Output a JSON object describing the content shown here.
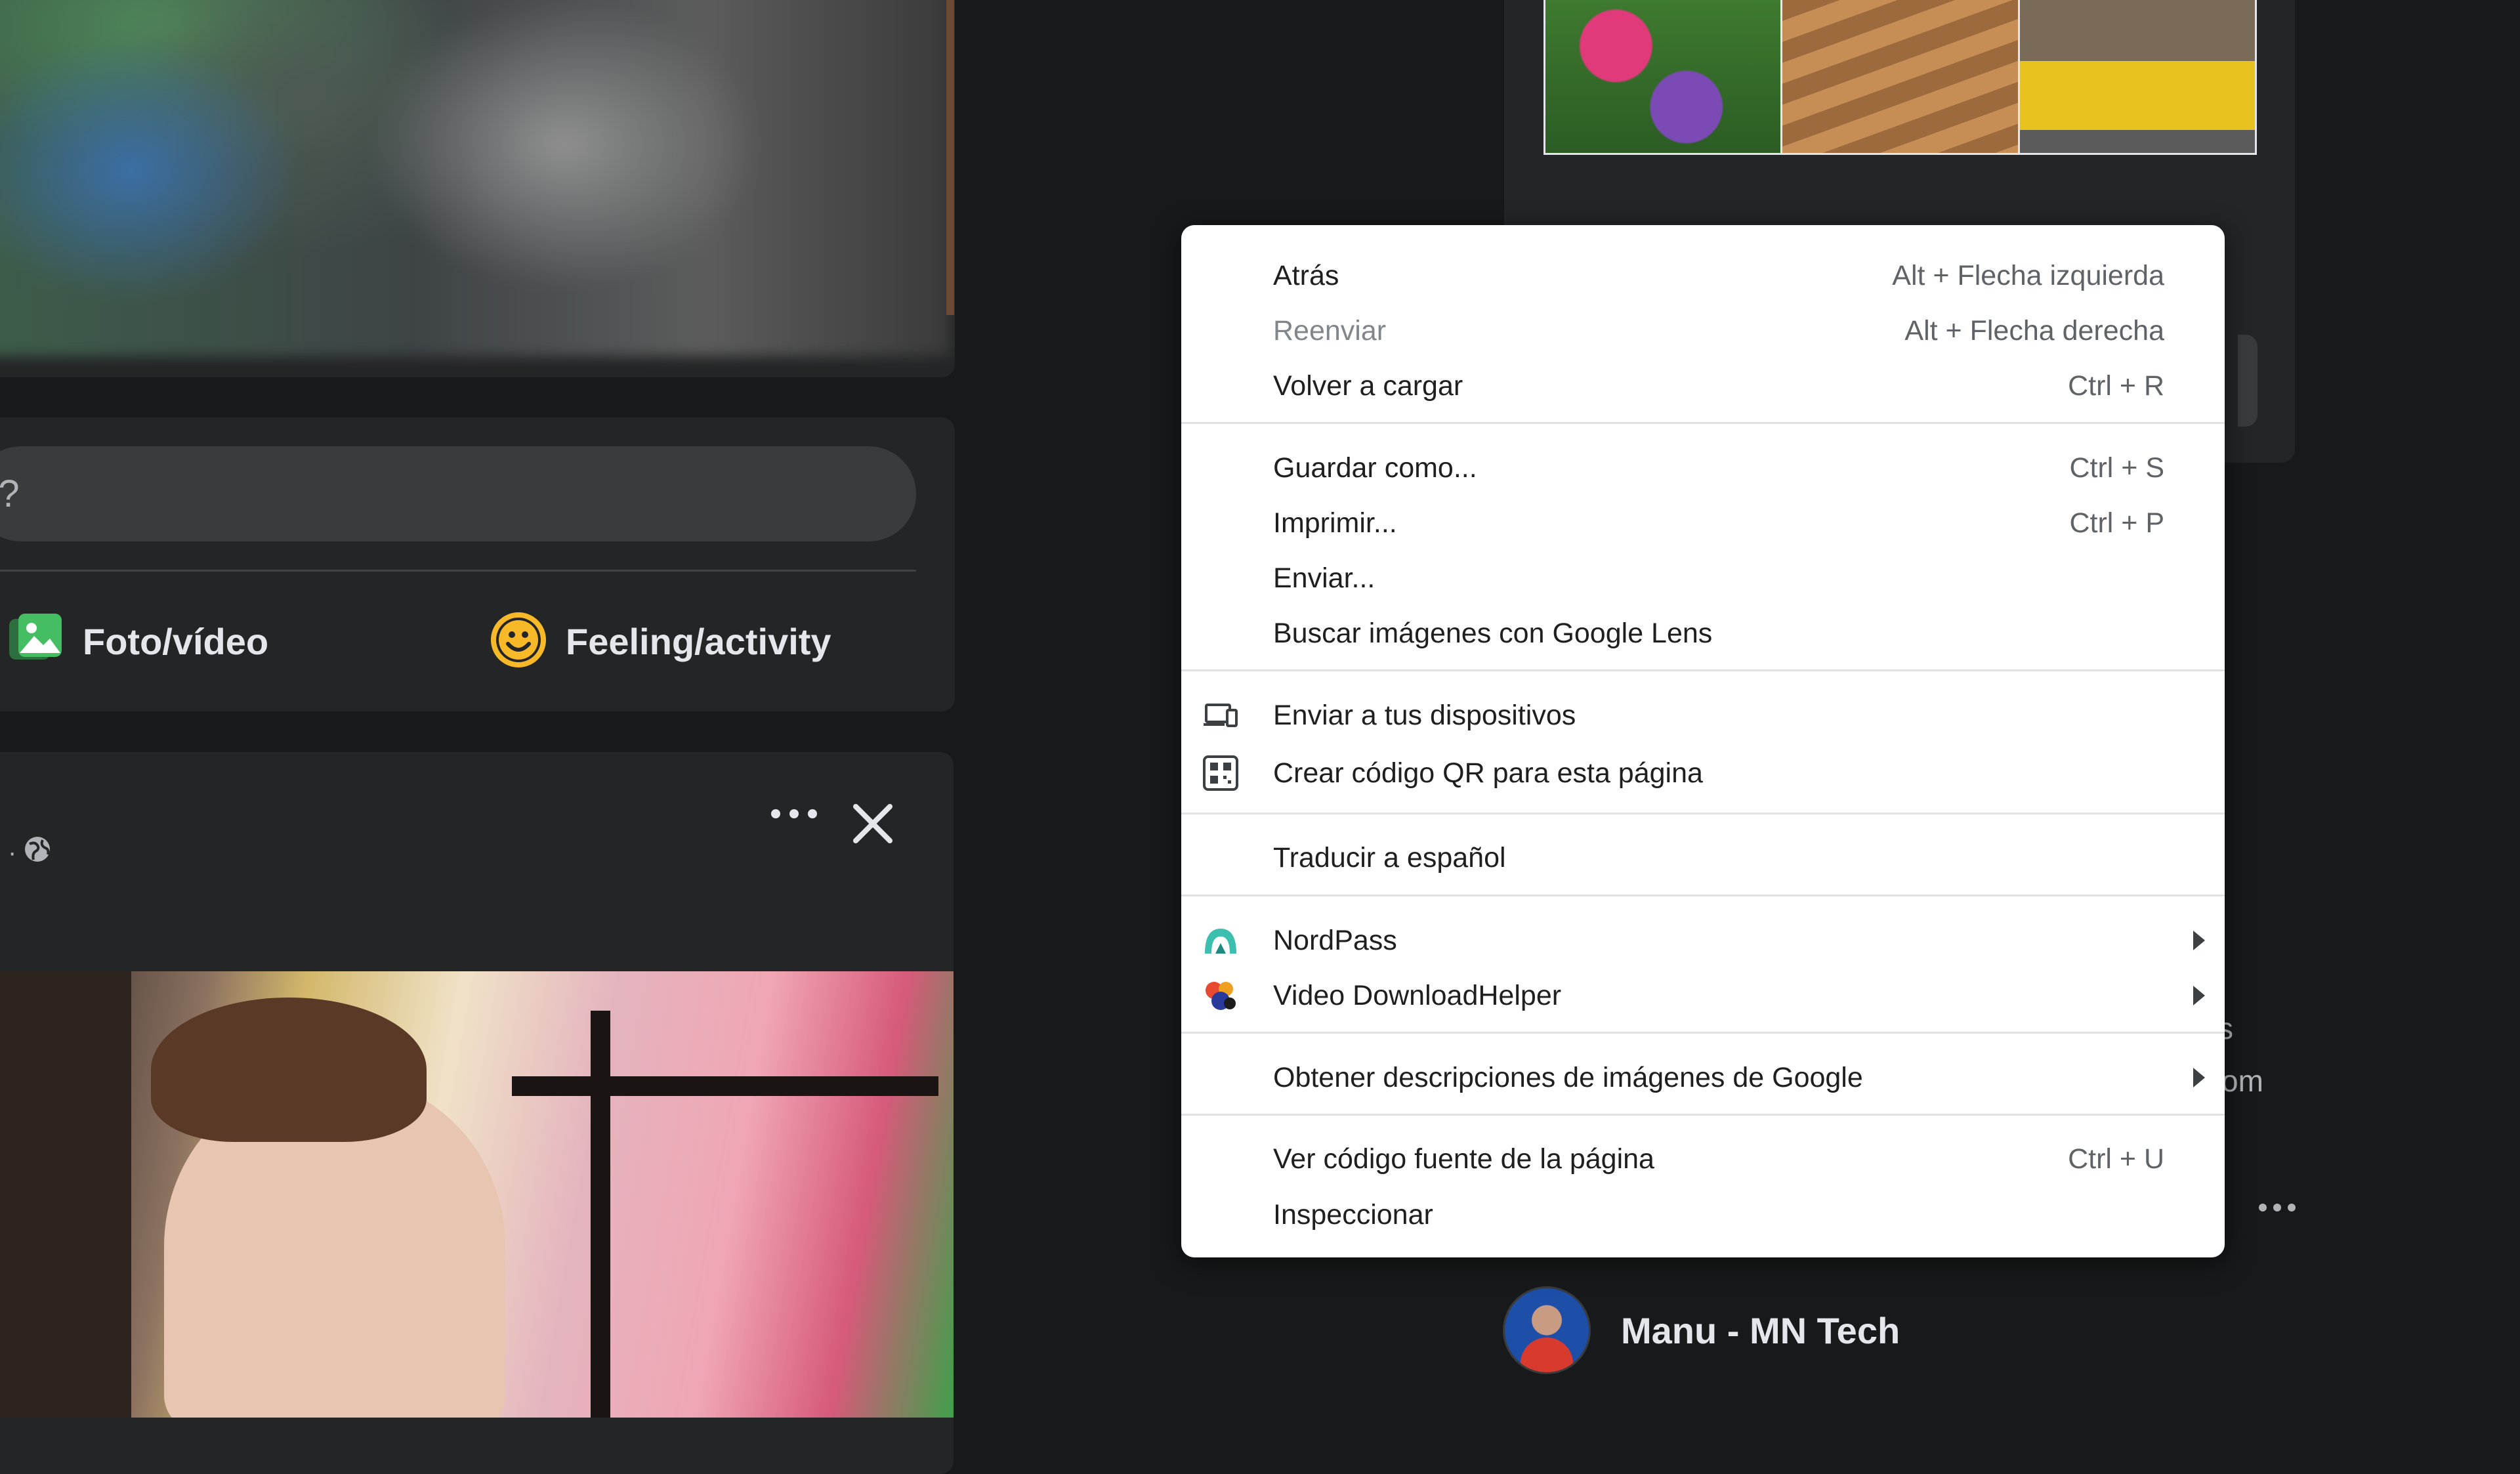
{
  "feed": {
    "compose_placeholder": "uel?",
    "photo_video_label": "Foto/vídeo",
    "feeling_label": "Feeling/activity",
    "post_meta_dot": "·"
  },
  "right_column": {
    "partial_text_s": "s",
    "partial_text_om": "om",
    "profile_name": "Manu - MN Tech"
  },
  "context_menu": {
    "items": [
      {
        "label": "Atrás",
        "shortcut": "Alt + Flecha izquierda",
        "enabled": true
      },
      {
        "label": "Reenviar",
        "shortcut": "Alt + Flecha derecha",
        "enabled": false
      },
      {
        "label": "Volver a cargar",
        "shortcut": "Ctrl + R",
        "enabled": true
      },
      {
        "label": "Guardar como...",
        "shortcut": "Ctrl + S",
        "enabled": true
      },
      {
        "label": "Imprimir...",
        "shortcut": "Ctrl + P",
        "enabled": true
      },
      {
        "label": "Enviar...",
        "shortcut": "",
        "enabled": true
      },
      {
        "label": "Buscar imágenes con Google Lens",
        "shortcut": "",
        "enabled": true
      },
      {
        "label": "Enviar a tus dispositivos",
        "icon": "devices-icon",
        "enabled": true
      },
      {
        "label": "Crear código QR para esta página",
        "icon": "qr-code-icon",
        "enabled": true
      },
      {
        "label": "Traducir a español",
        "enabled": true
      },
      {
        "label": "NordPass",
        "icon": "nordpass-icon",
        "submenu": true,
        "enabled": true
      },
      {
        "label": "Video DownloadHelper",
        "icon": "video-downloadhelper-icon",
        "submenu": true,
        "enabled": true
      },
      {
        "label": "Obtener descripciones de imágenes de Google",
        "submenu": true,
        "enabled": true
      },
      {
        "label": "Ver código fuente de la página",
        "shortcut": "Ctrl + U",
        "enabled": true
      },
      {
        "label": "Inspeccionar",
        "shortcut": "",
        "enabled": true
      }
    ]
  },
  "colors": {
    "page_bg": "#18191a",
    "card_bg": "#242526",
    "menu_bg": "#ffffff",
    "photo_icon_green": "#45bd62",
    "feeling_icon_yellow": "#f7b928",
    "nordpass_teal": "#3dbfb0"
  }
}
